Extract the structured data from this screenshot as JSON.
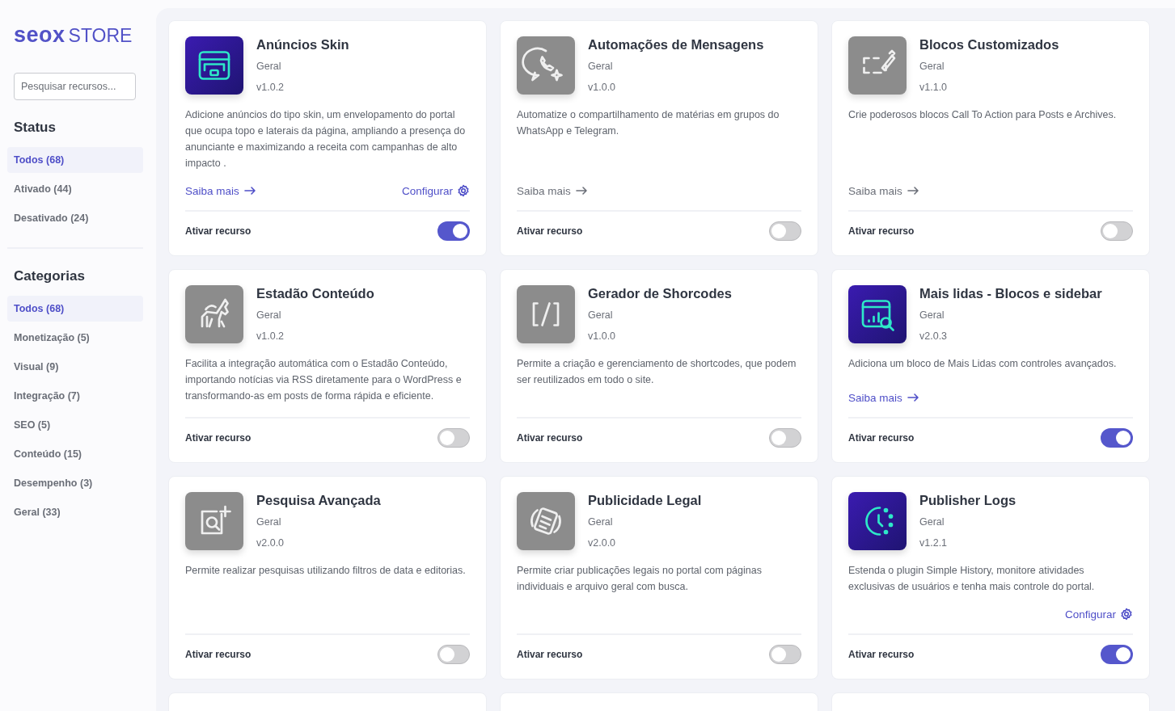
{
  "logo": {
    "brand": "seox",
    "product": "STORE"
  },
  "search": {
    "placeholder": "Pesquisar recursos..."
  },
  "filter_groups": [
    {
      "title": "Status",
      "items": [
        {
          "label": "Todos (68)",
          "selected": true
        },
        {
          "label": "Ativado (44)",
          "selected": false
        },
        {
          "label": "Desativado (24)",
          "selected": false
        }
      ]
    },
    {
      "title": "Categorias",
      "items": [
        {
          "label": "Todos (68)",
          "selected": true
        },
        {
          "label": "Monetização (5)",
          "selected": false
        },
        {
          "label": "Visual (9)",
          "selected": false
        },
        {
          "label": "Integração (7)",
          "selected": false
        },
        {
          "label": "SEO (5)",
          "selected": false
        },
        {
          "label": "Conteúdo (15)",
          "selected": false
        },
        {
          "label": "Desempenho (3)",
          "selected": false
        },
        {
          "label": "Geral (33)",
          "selected": false
        }
      ]
    }
  ],
  "plugins": [
    {
      "kind": "ad",
      "title": "Anúncios Skin",
      "category": "Geral",
      "version": "v1.0.2",
      "description": "Adicione anúncios do tipo skin, um envelopamento do portal que ocupa topo e laterais da página, ampliando a presença do anunciante e maximizando a receita com campanhas de alto impacto .",
      "learn_more": "Saiba mais",
      "configure": "Configurar",
      "toggle_label": "Ativar recurso",
      "on": true
    },
    {
      "kind": "chat",
      "title": "Automações de Mensagens",
      "category": "Geral",
      "version": "v1.0.0",
      "description": "Automatize o compartilhamento de matérias em grupos do WhatsApp e Telegram.",
      "learn_more": "Saiba mais",
      "toggle_label": "Ativar recurso",
      "on": false
    },
    {
      "kind": "blocks",
      "title": "Blocos Customizados",
      "category": "Geral",
      "version": "v1.1.0",
      "description": "Crie poderosos blocos Call To Action para Posts e Archives.",
      "learn_more": "Saiba mais",
      "toggle_label": "Ativar recurso",
      "on": false
    },
    {
      "kind": "horse",
      "title": "Estadão Conteúdo",
      "category": "Geral",
      "version": "v1.0.2",
      "description": "Facilita a integração automática com o Estadão Conteúdo, importando notícias via RSS diretamente para o WordPress e transformando-as em posts de forma rápida e eficiente.",
      "toggle_label": "Ativar recurso",
      "on": false
    },
    {
      "kind": "code",
      "title": "Gerador de Shorcodes",
      "category": "Geral",
      "version": "v1.0.0",
      "description": "Permite a criação e gerenciamento de shortcodes, que podem ser reutilizados em todo o site.",
      "toggle_label": "Ativar recurso",
      "on": false
    },
    {
      "kind": "chart",
      "title": "Mais lidas - Blocos e sidebar",
      "category": "Geral",
      "version": "v2.0.3",
      "description": "Adiciona um bloco de Mais Lidas com controles avançados.",
      "learn_more": "Saiba mais",
      "toggle_label": "Ativar recurso",
      "on": true
    },
    {
      "kind": "search",
      "title": "Pesquisa Avançada",
      "category": "Geral",
      "version": "v2.0.0",
      "description": "Permite realizar pesquisas utilizando filtros de data e editorias.",
      "toggle_label": "Ativar recurso",
      "on": false
    },
    {
      "kind": "document",
      "title": "Publicidade Legal",
      "category": "Geral",
      "version": "v2.0.0",
      "description": "Permite criar publicações legais no portal com páginas individuais e arquivo geral com busca.",
      "toggle_label": "Ativar recurso",
      "on": false
    },
    {
      "kind": "clock",
      "title": "Publisher Logs",
      "category": "Geral",
      "version": "v1.2.1",
      "description": "Estenda o plugin Simple History, monitore atividades exclusivas de usuários e tenha mais controle do portal.",
      "configure": "Configurar",
      "toggle_label": "Ativar recurso",
      "on": true
    }
  ]
}
